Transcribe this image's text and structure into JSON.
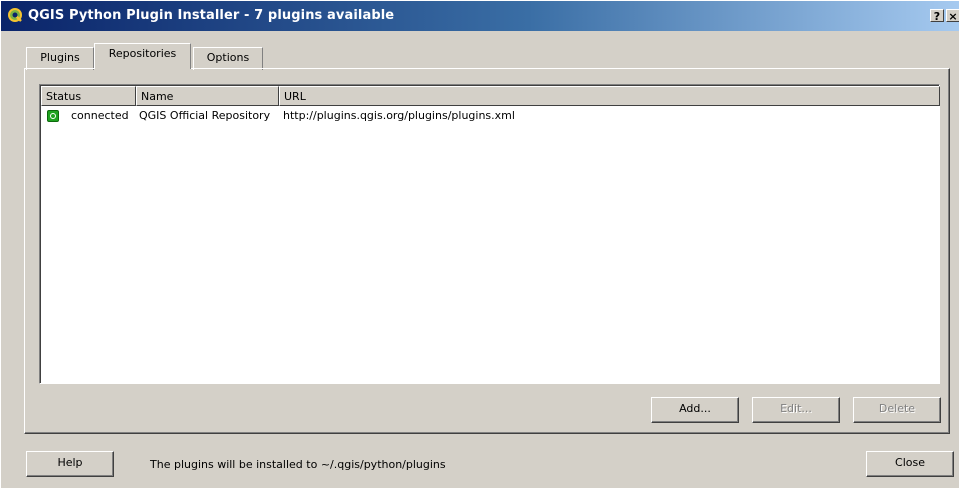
{
  "window": {
    "title": "QGIS Python Plugin Installer - 7 plugins available",
    "help_glyph": "?",
    "close_glyph": "×",
    "icon": "qgis-logo-icon"
  },
  "tabs": [
    {
      "label": "Plugins",
      "active": false
    },
    {
      "label": "Repositories",
      "active": true
    },
    {
      "label": "Options",
      "active": false
    }
  ],
  "table": {
    "columns": [
      "Status",
      "Name",
      "URL"
    ],
    "rows": [
      {
        "status_icon": "connected-icon",
        "status": "connected",
        "name": "QGIS Official Repository",
        "url": "http://plugins.qgis.org/plugins/plugins.xml"
      }
    ]
  },
  "panel_buttons": {
    "add": "Add...",
    "edit": "Edit...",
    "delete": "Delete"
  },
  "footer": {
    "help": "Help",
    "message": "The plugins will be installed to ~/.qgis/python/plugins",
    "close": "Close"
  },
  "colors": {
    "titlebar_start": "#0a246a",
    "titlebar_end": "#a6caf0",
    "face": "#d4d0c8",
    "status_connected": "#1fa31f"
  }
}
